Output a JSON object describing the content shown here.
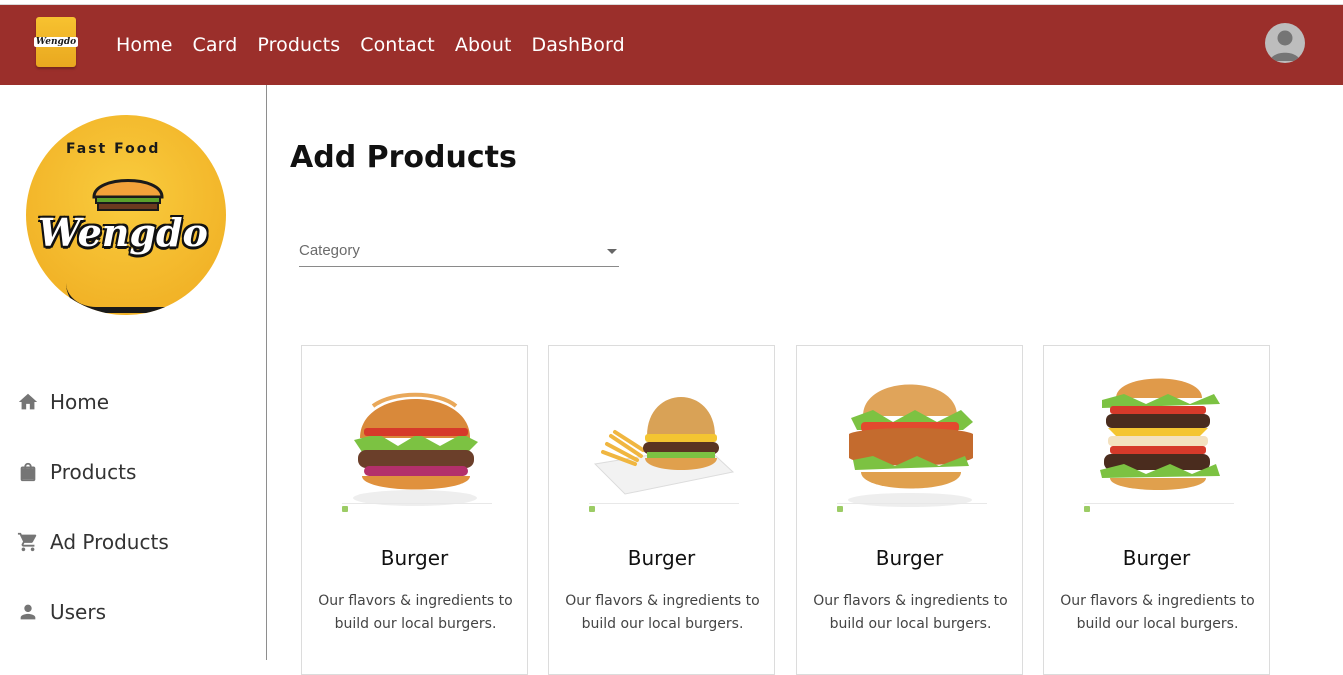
{
  "nav": {
    "brand_text": "Wengdo",
    "links": [
      "Home",
      "Card",
      "Products",
      "Contact",
      "About",
      "DashBord"
    ]
  },
  "sidebar": {
    "logo_top": "Fast Food",
    "logo_word": "Wengdo",
    "items": [
      {
        "label": "Home",
        "icon": "home-icon"
      },
      {
        "label": "Products",
        "icon": "bag-icon"
      },
      {
        "label": "Ad Products",
        "icon": "cart-icon"
      },
      {
        "label": "Users",
        "icon": "user-icon"
      }
    ]
  },
  "main": {
    "title": "Add Products",
    "category_select": {
      "placeholder": "Category"
    },
    "cards": [
      {
        "name": "Burger",
        "description": "Our flavors & ingredients to build our local burgers."
      },
      {
        "name": "Burger",
        "description": "Our flavors & ingredients to build our local burgers."
      },
      {
        "name": "Burger",
        "description": "Our flavors & ingredients to build our local burgers."
      },
      {
        "name": "Burger",
        "description": "Our flavors & ingredients to build our local burgers."
      }
    ]
  },
  "colors": {
    "navbar": "#9b2f2b",
    "logo_yellow": "#f5b92a",
    "accent_green": "#9ccc65"
  }
}
